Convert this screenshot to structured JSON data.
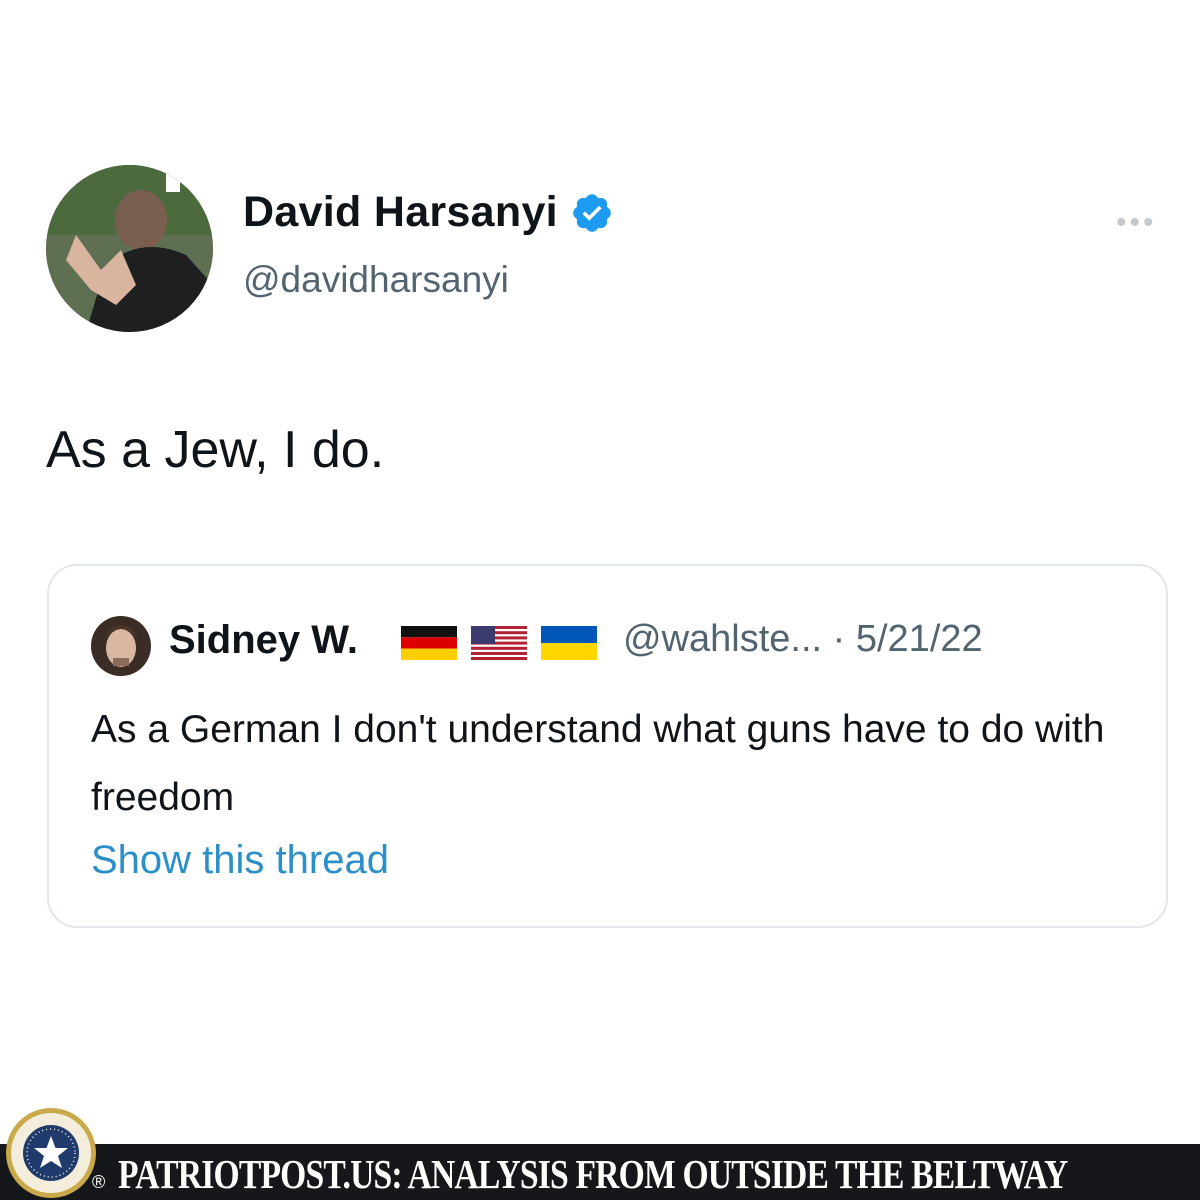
{
  "tweet": {
    "author_name": "David Harsanyi",
    "author_handle": "@davidharsanyi",
    "more_label": "•••",
    "text": "As a Jew, I do."
  },
  "quoted_tweet": {
    "author_name": "Sidney W.",
    "flags": [
      "german-flag",
      "us-flag",
      "ukraine-flag"
    ],
    "handle_and_date": "@wahlste... · 5/21/22",
    "text": "As a German I don't understand what guns have to do with freedom",
    "show_thread_label": "Show this thread"
  },
  "footer": {
    "banner_text": "PATRIOTPOST.US: ANALYSIS FROM OUTSIDE THE BELTWAY",
    "registered_mark": "®",
    "seal_text_top": "VERITAS VOS LIBERABIT",
    "seal_text_bottom": "SUSTINEO ESPRITUS PATRIOTAE"
  },
  "colors": {
    "verified_blue": "#1d9bf0",
    "link_blue": "#2b8fc9",
    "secondary_text": "#536471",
    "footer_background": "#15171b"
  }
}
